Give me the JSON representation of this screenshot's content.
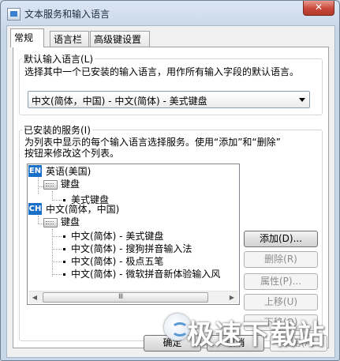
{
  "window": {
    "title": "文本服务和输入语言",
    "close_symbol": "✕"
  },
  "tabs": [
    {
      "label": "常规",
      "active": true
    },
    {
      "label": "语言栏",
      "active": false
    },
    {
      "label": "高级键设置",
      "active": false
    }
  ],
  "default_language": {
    "group_title": "默认输入语言(L)",
    "description": "选择其中一个已安装的输入语言，用作所有输入字段的默认语言。",
    "selected": "中文(简体，中国) - 中文(简体) - 美式键盘"
  },
  "installed_services": {
    "group_title": "已安装的服务(I)",
    "description_line1": "为列表中显示的每个输入语言选择服务。使用“添加”和“删除”",
    "description_line2": "按钮来修改这个列表。",
    "tree": [
      {
        "type": "language",
        "icon": "EN",
        "label": "英语(美国)"
      },
      {
        "type": "category",
        "icon": "keyboard-icon",
        "label": "键盘"
      },
      {
        "type": "item",
        "label": "美式键盘"
      },
      {
        "type": "language",
        "icon": "CH",
        "label": "中文(简体，中国)"
      },
      {
        "type": "category",
        "icon": "keyboard-icon",
        "label": "键盘"
      },
      {
        "type": "item",
        "label": "中文(简体) - 美式键盘"
      },
      {
        "type": "item",
        "label": "中文(简体) - 搜狗拼音输入法"
      },
      {
        "type": "item",
        "label": "中文(简体) - 极点五笔"
      },
      {
        "type": "item",
        "label": "中文(简体) - 微软拼音新体验输入风"
      }
    ],
    "scroll_grip": "Ⅲ",
    "buttons": {
      "add": "添加(D)...",
      "remove": "删除(R)",
      "properties": "属性(P)...",
      "move_up": "上移(U)",
      "move_down": "下移(O)"
    }
  },
  "footer": {
    "ok": "确定",
    "cancel": "取消",
    "apply": "应用(A)"
  },
  "watermark": {
    "text": "极速下载站"
  },
  "colors": {
    "accent": "#1a6fc9",
    "close_button": "#c9473a"
  }
}
